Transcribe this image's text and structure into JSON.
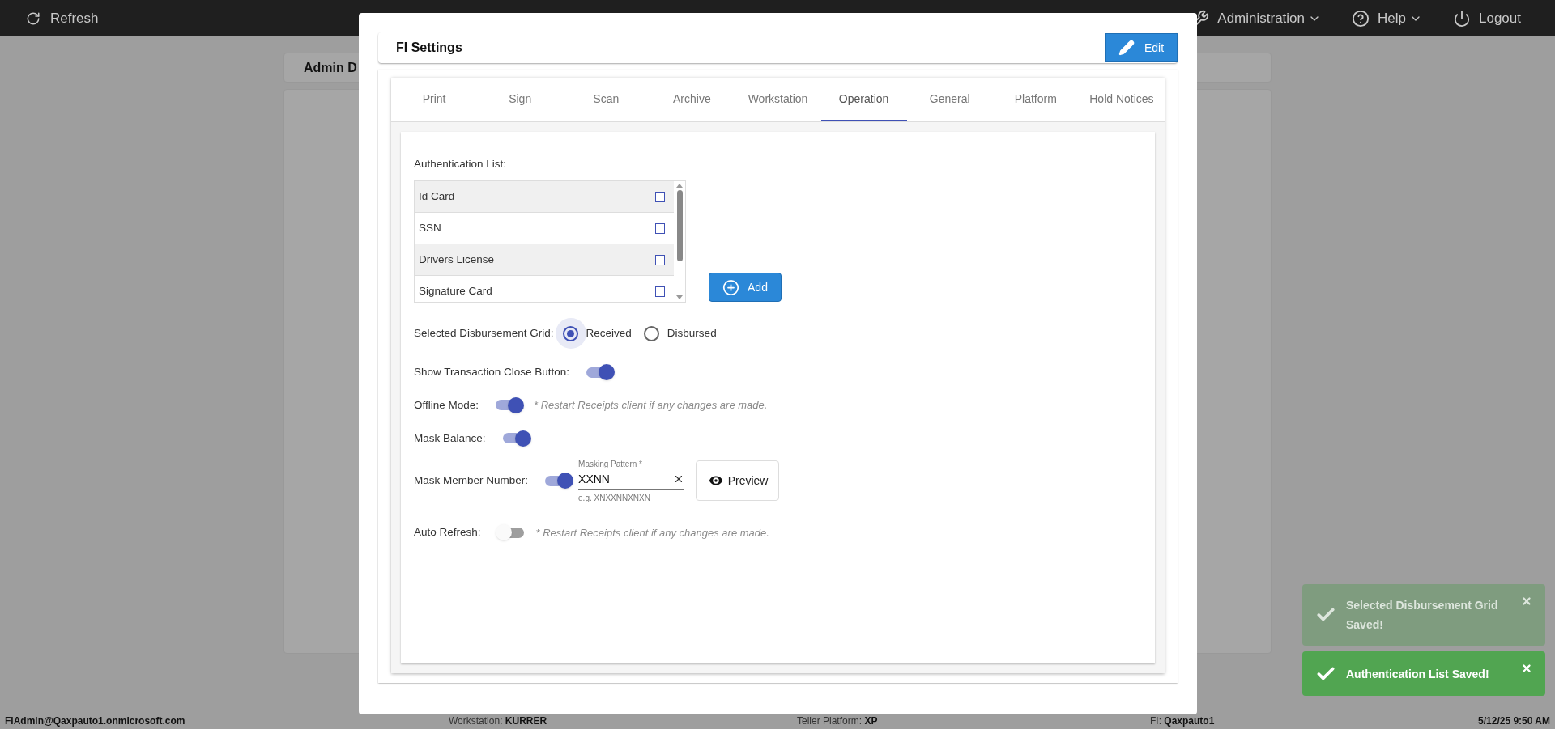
{
  "topbar": {
    "refresh": "Refresh",
    "menus": [
      {
        "label": "Administration",
        "kind": "dropdown"
      },
      {
        "label": "Help",
        "kind": "dropdown"
      },
      {
        "label": "Logout",
        "kind": "logout"
      }
    ]
  },
  "background": {
    "card_title": "Admin D"
  },
  "dialog": {
    "title": "FI Settings",
    "edit_button": "Edit",
    "tabs": [
      {
        "label": "Print",
        "selected": false
      },
      {
        "label": "Sign",
        "selected": false
      },
      {
        "label": "Scan",
        "selected": false
      },
      {
        "label": "Archive",
        "selected": false
      },
      {
        "label": "Workstation",
        "selected": false
      },
      {
        "label": "Operation",
        "selected": true
      },
      {
        "label": "General",
        "selected": false
      },
      {
        "label": "Platform",
        "selected": false
      },
      {
        "label": "Hold Notices",
        "selected": false
      }
    ],
    "authentication": {
      "label": "Authentication List:",
      "add_button": "Add",
      "items": [
        {
          "label": "Id Card",
          "checked": false
        },
        {
          "label": "SSN",
          "checked": false
        },
        {
          "label": "Drivers License",
          "checked": false
        },
        {
          "label": "Signature Card",
          "checked": false
        }
      ]
    },
    "disbursement_grid": {
      "label": "Selected Disbursement Grid:",
      "options": [
        {
          "label": "Received",
          "selected": true
        },
        {
          "label": "Disbursed",
          "selected": false
        }
      ]
    },
    "settings": [
      {
        "kind": "toggle",
        "label": "Show Transaction Close Button:",
        "on": true
      },
      {
        "kind": "toggle",
        "label": "Offline Mode:",
        "on": true,
        "note": "* Restart Receipts client if any changes are made."
      },
      {
        "kind": "toggle",
        "label": "Mask Balance:",
        "on": true
      },
      {
        "kind": "masked",
        "label": "Mask Member Number:",
        "on": true,
        "field": {
          "label": "Masking Pattern *",
          "value": "XXNN",
          "hint": "e.g. XNXXNNXNXN"
        },
        "preview_button": "Preview"
      },
      {
        "kind": "toggle",
        "label": "Auto Refresh:",
        "on": false,
        "note": "* Restart Receipts client if any changes are made."
      }
    ]
  },
  "toasts": [
    {
      "message": "Selected Disbursement Grid Saved!",
      "dimmed": true
    },
    {
      "message": "Authentication List Saved!",
      "dimmed": false
    }
  ],
  "footer": {
    "user": "FiAdmin@Qaxpauto1.onmicrosoft.com",
    "fields": [
      {
        "label": "Workstation:",
        "value": "KURRER"
      },
      {
        "label": "Teller Platform:",
        "value": "XP"
      },
      {
        "label": "FI:",
        "value": "Qaxpauto1"
      }
    ],
    "datetime": "5/12/25 9:50 AM"
  }
}
